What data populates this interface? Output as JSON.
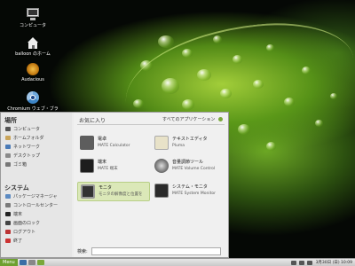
{
  "desktop": {
    "icons": [
      {
        "label": "コンピュータ",
        "icon": "computer-icon"
      },
      {
        "label": "balloon のホーム",
        "icon": "home-folder-icon"
      },
      {
        "label": "Audacious",
        "icon": "audacious-icon"
      },
      {
        "label": "Chromium ウェブ・ブラ",
        "icon": "chromium-icon"
      }
    ]
  },
  "menu": {
    "places_title": "場所",
    "places": [
      {
        "label": "コンピュータ"
      },
      {
        "label": "ホームフォルダ"
      },
      {
        "label": "ネットワーク"
      },
      {
        "label": "デスクトップ"
      },
      {
        "label": "ゴミ箱"
      }
    ],
    "system_title": "システム",
    "system": [
      {
        "label": "パッケージマネージャ"
      },
      {
        "label": "コントロールセンター"
      },
      {
        "label": "端末"
      },
      {
        "label": "画面のロック"
      },
      {
        "label": "ログアウト"
      },
      {
        "label": "終了"
      }
    ],
    "favorites_title": "お気に入り",
    "all_apps_label": "すべてのアプリケーション",
    "apps": [
      {
        "name": "電卓",
        "desc": "MATE Calculator",
        "icon": "calculator-icon"
      },
      {
        "name": "テキストエディタ",
        "desc": "Pluma",
        "icon": "text-editor-icon"
      },
      {
        "name": "端末",
        "desc": "MATE 端末",
        "icon": "terminal-icon"
      },
      {
        "name": "音量調節ツール",
        "desc": "MATE Volume Control",
        "icon": "volume-control-icon"
      },
      {
        "name": "モニタ",
        "desc": "モニタの解像度と位置を",
        "icon": "display-icon"
      },
      {
        "name": "システム・モニタ",
        "desc": "MATE System Monitor",
        "icon": "system-monitor-icon"
      }
    ],
    "search_label": "検索:",
    "search_value": ""
  },
  "panel": {
    "menu_label": "Menu",
    "clock": "3月30日 (日) 10:09"
  }
}
